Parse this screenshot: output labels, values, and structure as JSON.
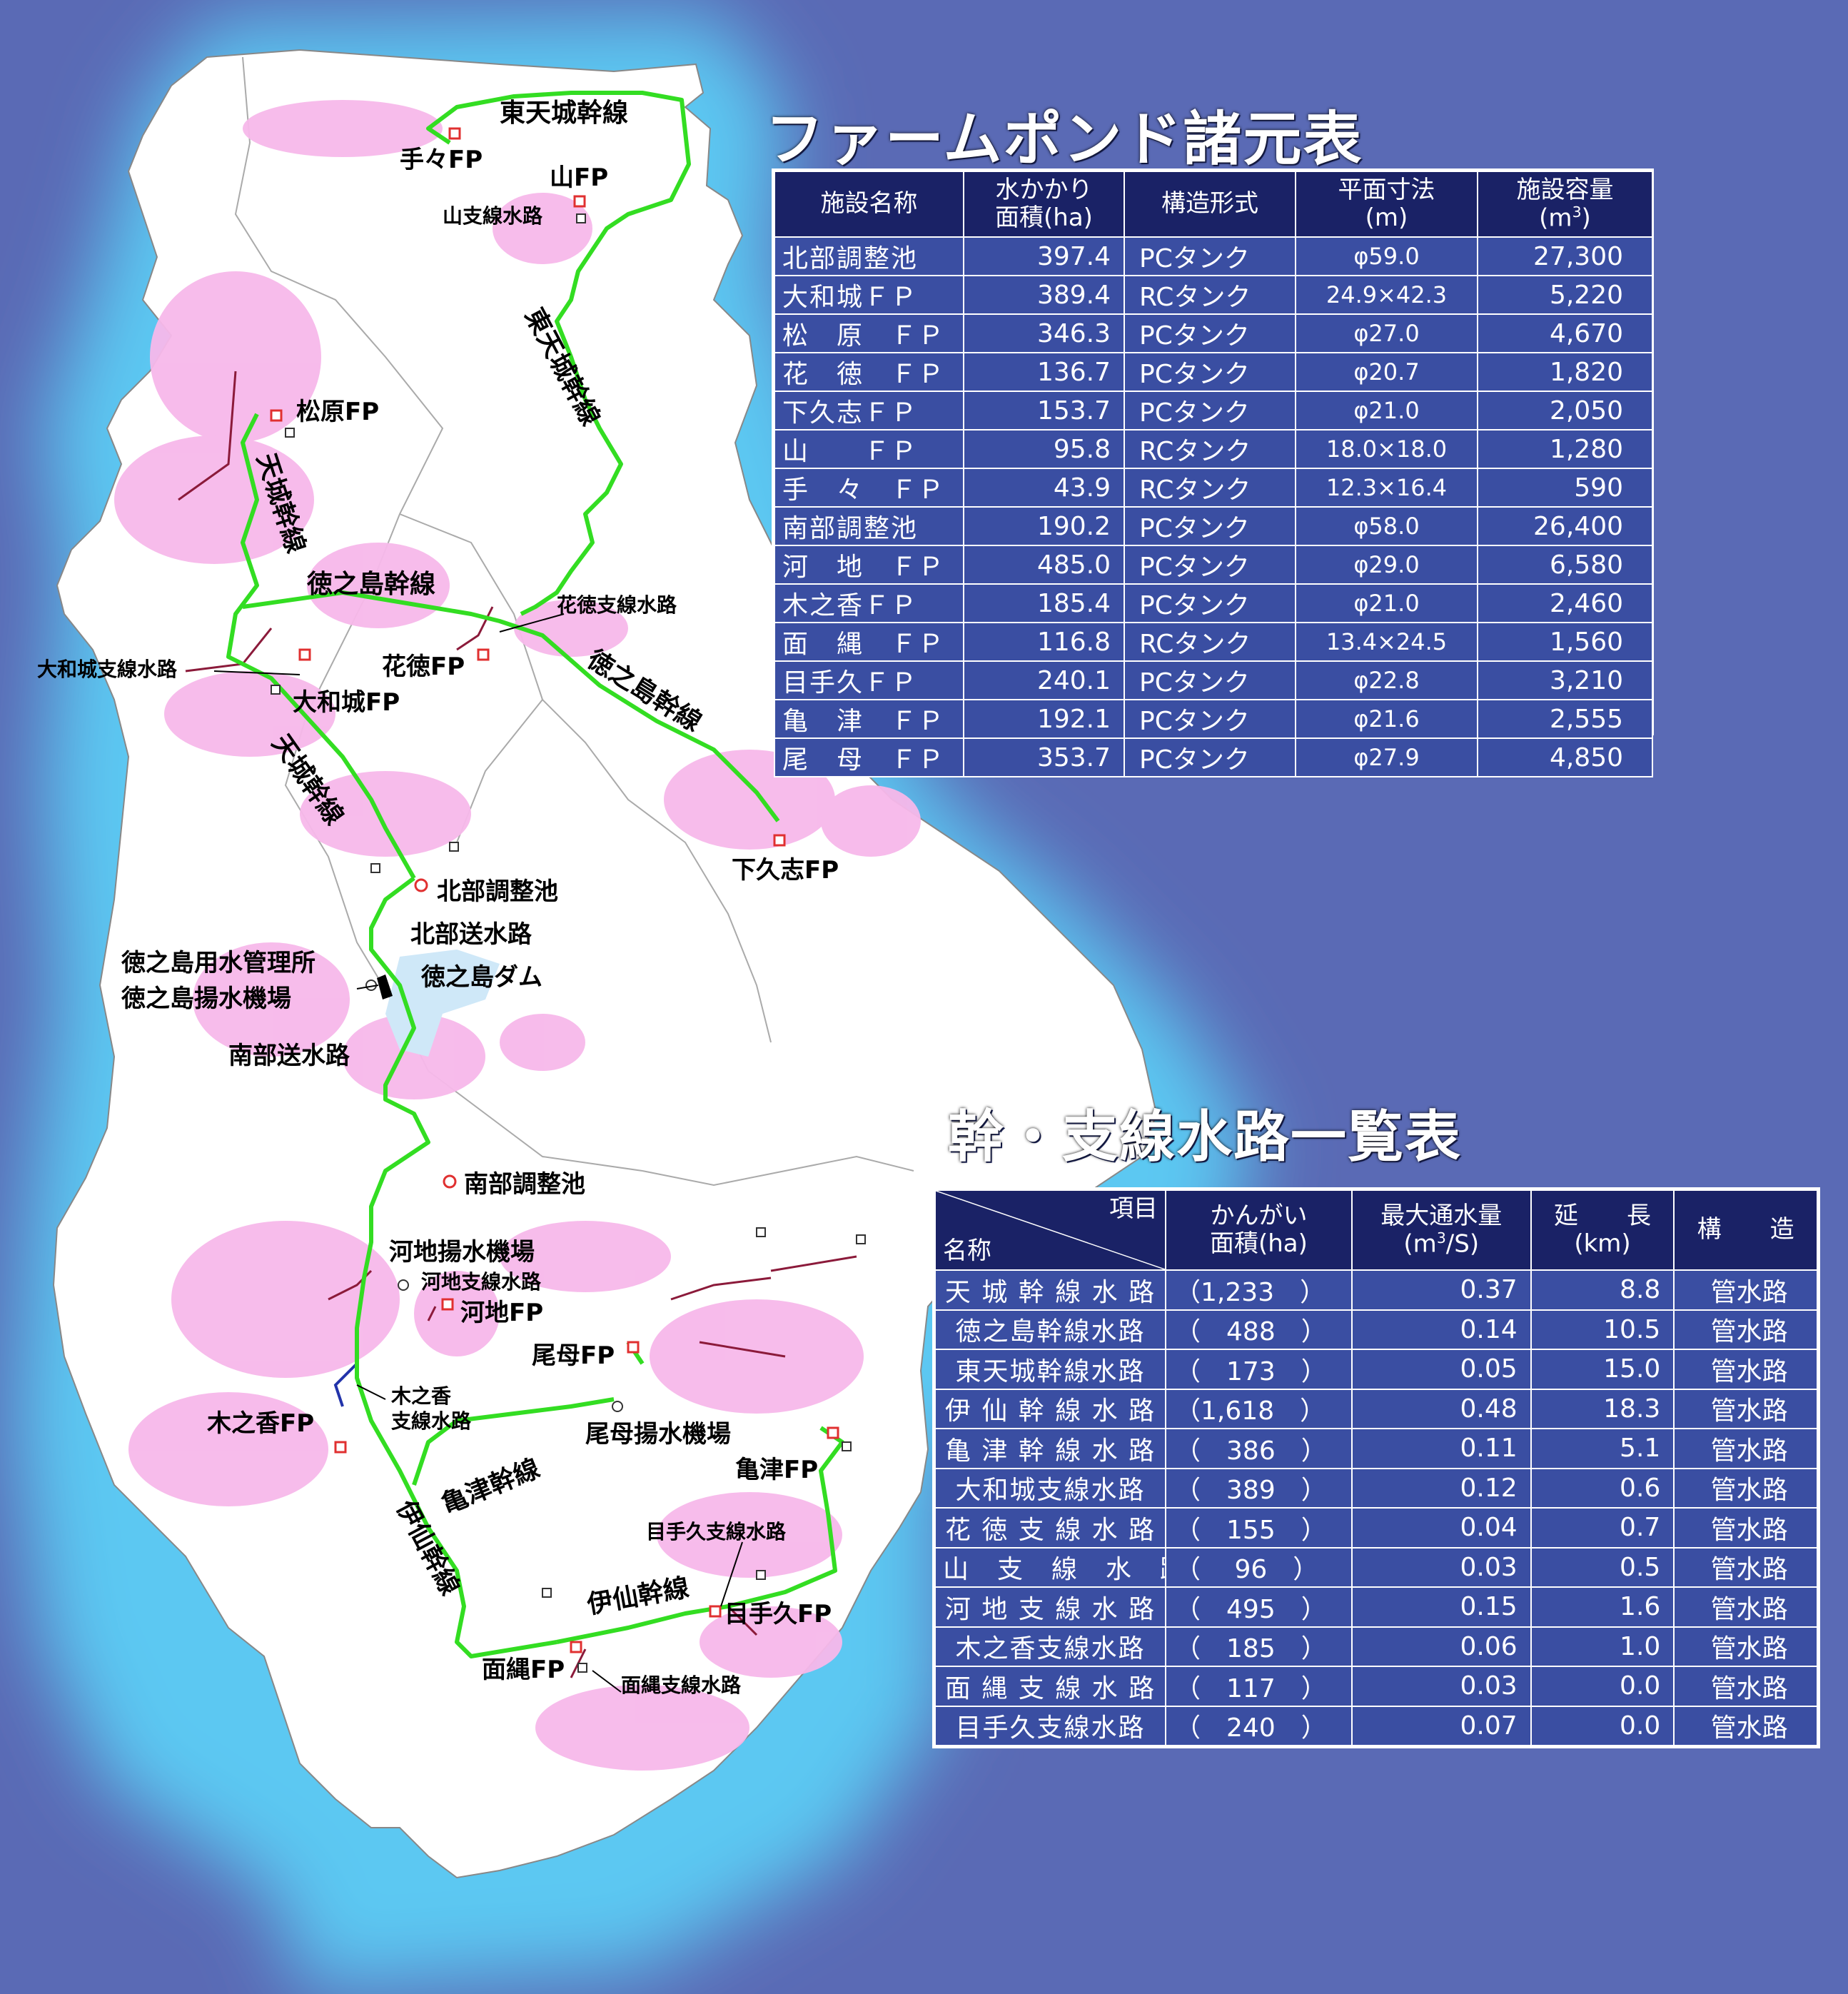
{
  "map": {
    "labels": {
      "east_tenjo_main_n": "東天城幹線",
      "tete_fp": "手々FP",
      "yama_fp": "山FP",
      "yama_branch": "山支線水路",
      "east_tenjo_main_v": "東天城幹線",
      "matsubara_fp": "松原FP",
      "tenjo_main_n": "天城幹線",
      "tokunoshima_main_n": "徳之島幹線",
      "katoku_branch": "花徳支線水路",
      "yamatojo_branch": "大和城支線水路",
      "katoku_fp": "花徳FP",
      "yamatojo_fp": "大和城FP",
      "tokunoshima_main_e": "徳之島幹線",
      "tenjo_main_s": "天城幹線",
      "shimokushi_fp": "下久志FP",
      "north_pond": "北部調整池",
      "north_conduit": "北部送水路",
      "mgmt_office": "徳之島用水管理所",
      "pump_station": "徳之島揚水機場",
      "dam": "徳之島ダム",
      "south_conduit": "南部送水路",
      "south_pond": "南部調整池",
      "kawachi_pump": "河地揚水機場",
      "kawachi_branch": "河地支線水路",
      "kawachi_fp": "河地FP",
      "omo_fp": "尾母FP",
      "kinoko_branch_1": "木之香",
      "kinoko_branch_2": "支線水路",
      "kinoko_fp": "木之香FP",
      "omo_pump": "尾母揚水機場",
      "kametsu_main": "亀津幹線",
      "kametsu_fp": "亀津FP",
      "isen_main_v": "伊仙幹線",
      "metekyu_branch": "目手久支線水路",
      "isen_main_h": "伊仙幹線",
      "metekyu_fp": "目手久FP",
      "omonawa_fp": "面縄FP",
      "omonawa_branch": "面縄支線水路"
    },
    "colors": {
      "sea_deep": "#5a6ab5",
      "sea_shallow": "#5cc8f2",
      "land": "#ffffff",
      "farmland": "#f7b8ea",
      "main_canal": "#33dd22",
      "branch_canal": "#8b1a3a",
      "facility": "#e03030"
    }
  },
  "farmpond_table": {
    "title": "ファームポンド諸元表",
    "headers": {
      "name": "施設名称",
      "area_1": "水かかり",
      "area_2": "面積(ha)",
      "type": "構造形式",
      "dim_1": "平面寸法",
      "dim_2": "(m)",
      "cap_1": "施設容量",
      "cap_2": "(m",
      "cap_sup": "3",
      "cap_3": ")"
    },
    "rows": [
      {
        "name": "北部調整池",
        "area": "397.4",
        "type": "PCタンク",
        "dim": "φ59.0",
        "cap": "27,300"
      },
      {
        "name": "大和城ＦＰ",
        "area": "389.4",
        "type": "RCタンク",
        "dim": "24.9×42.3",
        "cap": "5,220"
      },
      {
        "name": "松　原　ＦＰ",
        "area": "346.3",
        "type": "PCタンク",
        "dim": "φ27.0",
        "cap": "4,670"
      },
      {
        "name": "花　徳　ＦＰ",
        "area": "136.7",
        "type": "PCタンク",
        "dim": "φ20.7",
        "cap": "1,820"
      },
      {
        "name": "下久志ＦＰ",
        "area": "153.7",
        "type": "PCタンク",
        "dim": "φ21.0",
        "cap": "2,050"
      },
      {
        "name": "山　　ＦＰ",
        "area": "95.8",
        "type": "RCタンク",
        "dim": "18.0×18.0",
        "cap": "1,280"
      },
      {
        "name": "手　々　ＦＰ",
        "area": "43.9",
        "type": "RCタンク",
        "dim": "12.3×16.4",
        "cap": "590"
      },
      {
        "name": "南部調整池",
        "area": "190.2",
        "type": "PCタンク",
        "dim": "φ58.0",
        "cap": "26,400"
      },
      {
        "name": "河　地　ＦＰ",
        "area": "485.0",
        "type": "PCタンク",
        "dim": "φ29.0",
        "cap": "6,580"
      },
      {
        "name": "木之香ＦＰ",
        "area": "185.4",
        "type": "PCタンク",
        "dim": "φ21.0",
        "cap": "2,460"
      },
      {
        "name": "面　縄　ＦＰ",
        "area": "116.8",
        "type": "RCタンク",
        "dim": "13.4×24.5",
        "cap": "1,560"
      },
      {
        "name": "目手久ＦＰ",
        "area": "240.1",
        "type": "PCタンク",
        "dim": "φ22.8",
        "cap": "3,210"
      },
      {
        "name": "亀　津　ＦＰ",
        "area": "192.1",
        "type": "PCタンク",
        "dim": "φ21.6",
        "cap": "2,555"
      },
      {
        "name": "尾　母　ＦＰ",
        "area": "353.7",
        "type": "PCタンク",
        "dim": "φ27.9",
        "cap": "4,850"
      }
    ]
  },
  "channel_table": {
    "title": "幹・支線水路一覧表",
    "headers": {
      "item": "項目",
      "name": "名称",
      "area_1": "かんがい",
      "area_2": "面積(ha)",
      "flow_1": "最大通水量",
      "flow_2a": "(m",
      "flow_sup": "3",
      "flow_2b": "/S)",
      "len_1": "延　　長",
      "len_2": "(km)",
      "struct": "構　　造"
    },
    "rows": [
      {
        "name": "天 城 幹 線 水 路",
        "area": "（1,233　）",
        "flow": "0.37",
        "len": "8.8",
        "struct": "管水路"
      },
      {
        "name": "徳之島幹線水路",
        "area": "（　488　）",
        "flow": "0.14",
        "len": "10.5",
        "struct": "管水路"
      },
      {
        "name": "東天城幹線水路",
        "area": "（　173　）",
        "flow": "0.05",
        "len": "15.0",
        "struct": "管水路"
      },
      {
        "name": "伊 仙 幹 線 水 路",
        "area": "（1,618　）",
        "flow": "0.48",
        "len": "18.3",
        "struct": "管水路"
      },
      {
        "name": "亀 津 幹 線 水 路",
        "area": "（　386　）",
        "flow": "0.11",
        "len": "5.1",
        "struct": "管水路"
      },
      {
        "name": "大和城支線水路",
        "area": "（　389　）",
        "flow": "0.12",
        "len": "0.6",
        "struct": "管水路"
      },
      {
        "name": "花 徳 支 線 水 路",
        "area": "（　155　）",
        "flow": "0.04",
        "len": "0.7",
        "struct": "管水路"
      },
      {
        "name": "山　支　線　水　路",
        "area": "（　 96　）",
        "flow": "0.03",
        "len": "0.5",
        "struct": "管水路"
      },
      {
        "name": "河 地 支 線 水 路",
        "area": "（　495　）",
        "flow": "0.15",
        "len": "1.6",
        "struct": "管水路"
      },
      {
        "name": "木之香支線水路",
        "area": "（　185　）",
        "flow": "0.06",
        "len": "1.0",
        "struct": "管水路"
      },
      {
        "name": "面 縄 支 線 水 路",
        "area": "（　117　）",
        "flow": "0.03",
        "len": "0.0",
        "struct": "管水路"
      },
      {
        "name": "目手久支線水路",
        "area": "（　240　）",
        "flow": "0.07",
        "len": "0.0",
        "struct": "管水路"
      }
    ]
  }
}
